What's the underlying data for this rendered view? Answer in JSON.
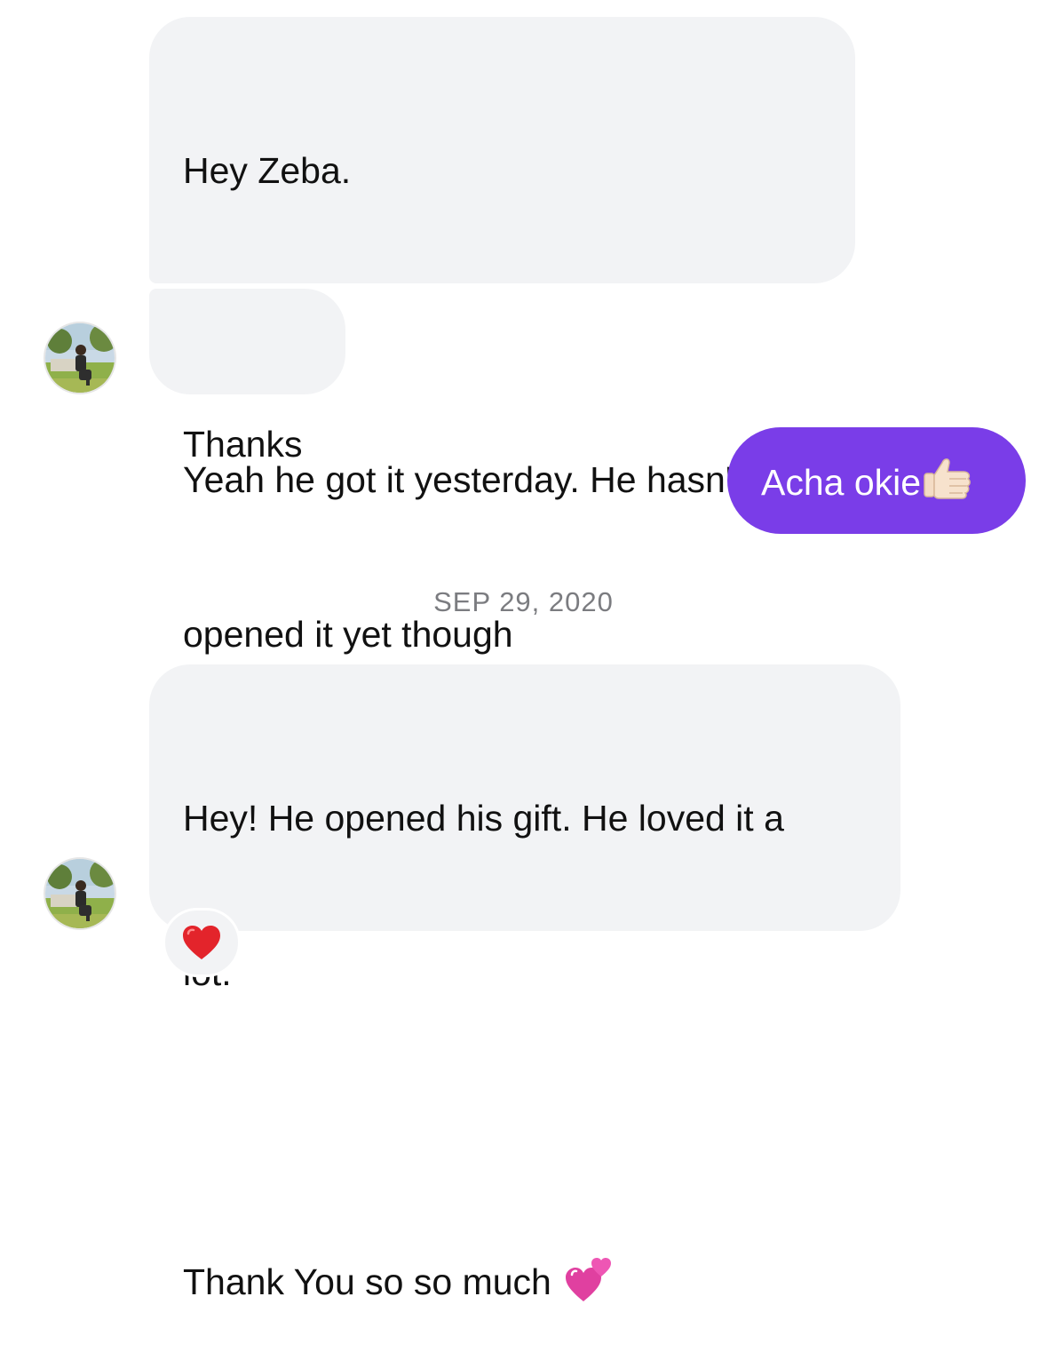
{
  "messages": [
    {
      "lines": [
        "Hey Zeba.",
        "",
        "Yeah he got it yesterday. He hasn't",
        "opened it yet though"
      ]
    },
    {
      "text": "Thanks"
    },
    {
      "text": "Acha okie",
      "icon": "thumbs-up-icon"
    },
    {
      "lines": [
        "Hey! He opened his gift. He loved it a",
        "lot.",
        "",
        "Thank You so so much"
      ],
      "icon": "two-hearts-icon",
      "reaction": "red-heart-icon"
    }
  ],
  "date_separator": "SEP 29, 2020",
  "colors": {
    "incoming_bubble": "#f2f3f5",
    "outgoing_bubble": "#7a3de8",
    "date_text": "#7b7c80",
    "heart_red": "#e3242b",
    "hearts_pink": "#e040a0"
  }
}
